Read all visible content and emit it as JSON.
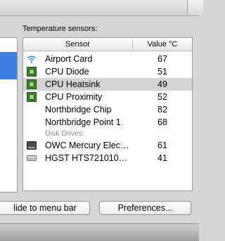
{
  "panel": {
    "section_label": "Temperature sensors:",
    "columns": {
      "sensor": "Sensor",
      "value": "Value °C"
    }
  },
  "sensors": [
    {
      "name": "Airport Card",
      "value": "67",
      "icon": "wifi-icon"
    },
    {
      "name": "CPU Diode",
      "value": "51",
      "icon": "chip-icon"
    },
    {
      "name": "CPU Heatsink",
      "value": "49",
      "icon": "chip-icon",
      "selected": true
    },
    {
      "name": "CPU Proximity",
      "value": "52",
      "icon": "chip-icon"
    },
    {
      "name": "Northbridge Chip",
      "value": "82",
      "icon": ""
    },
    {
      "name": "Northbridge Point 1",
      "value": "68",
      "icon": ""
    }
  ],
  "disk_group": {
    "label": "Disk Drives:",
    "items": [
      {
        "name": "OWC Mercury Elec…",
        "value": "61",
        "icon": "ssd-icon"
      },
      {
        "name": "HGST HTS721010…",
        "value": "41",
        "icon": "hard-drive-icon"
      }
    ]
  },
  "buttons": {
    "hide": "Hide to menu bar",
    "hide_visible": "lide to menu bar",
    "preferences": "Preferences..."
  },
  "colors": {
    "selection_blue": "#3d80df",
    "selected_row": "#d4d4d4",
    "group_label": "#8a8a8a"
  }
}
